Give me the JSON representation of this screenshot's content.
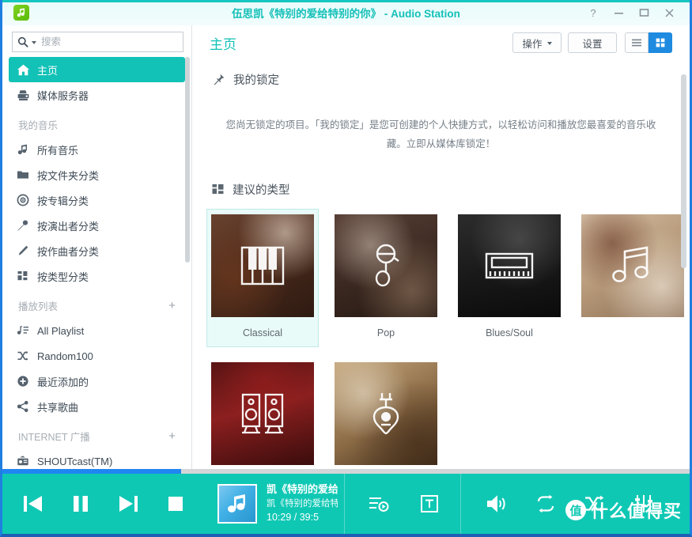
{
  "window": {
    "title": "伍思凯《特别的爱给特别的你》 - Audio Station",
    "app_icon": "music-note-app-icon",
    "accent_teal": "#12c2b6",
    "accent_blue": "#1e8ae0",
    "border_blue": "#1f7fe0",
    "controls": {
      "help": "?",
      "minimize": "—",
      "maximize": "□",
      "close": "✕"
    }
  },
  "sidebar": {
    "search": {
      "placeholder": "搜索",
      "value": ""
    },
    "items": [
      {
        "label": "主页",
        "icon": "home-icon",
        "active": true
      },
      {
        "label": "媒体服务器",
        "icon": "media-server-icon",
        "active": false
      }
    ],
    "groups": [
      {
        "title": "我的音乐",
        "add": "",
        "items": [
          {
            "label": "所有音乐",
            "icon": "music-note-icon"
          },
          {
            "label": "按文件夹分类",
            "icon": "folder-icon"
          },
          {
            "label": "按专辑分类",
            "icon": "disc-icon"
          },
          {
            "label": "按演出者分类",
            "icon": "microphone-icon"
          },
          {
            "label": "按作曲者分类",
            "icon": "pen-icon"
          },
          {
            "label": "按类型分类",
            "icon": "grid-icon"
          }
        ]
      },
      {
        "title": "播放列表",
        "add": "+",
        "items": [
          {
            "label": "All Playlist",
            "icon": "playlist-icon"
          },
          {
            "label": "Random100",
            "icon": "shuffle-icon"
          },
          {
            "label": "最近添加的",
            "icon": "plus-circle-icon"
          },
          {
            "label": "共享歌曲",
            "icon": "share-icon"
          }
        ]
      },
      {
        "title": "INTERNET 广播",
        "add": "+",
        "items": [
          {
            "label": "SHOUTcast(TM)",
            "icon": "radio-icon"
          }
        ]
      }
    ]
  },
  "content": {
    "page_title": "主页",
    "toolbar": {
      "action_label": "操作",
      "settings_label": "设置",
      "list_view_icon": "list-view-icon",
      "grid_view_icon": "grid-view-icon",
      "active_view": "grid"
    },
    "pinned_section": {
      "icon": "pin-icon",
      "title": "我的锁定",
      "empty_message": "您尚无锁定的项目。「我的锁定」是您可创建的个人快捷方式，以轻松访问和播放您最喜爱的音乐收藏。立即从媒体库锁定！"
    },
    "genres_section": {
      "icon": "grid-icon",
      "title": "建议的类型",
      "cards": [
        {
          "label": "Classical",
          "icon": "piano-icon",
          "photo": "ph-classical",
          "selected": true
        },
        {
          "label": "Pop",
          "icon": "microphone-icon",
          "photo": "ph-pop",
          "selected": false
        },
        {
          "label": "Blues/Soul",
          "icon": "harmonica-icon",
          "photo": "ph-blues",
          "selected": false
        },
        {
          "label": "",
          "icon": "double-note-icon",
          "photo": "ph-easy",
          "selected": false
        },
        {
          "label": "",
          "icon": "speakers-icon",
          "photo": "ph-soundtrack",
          "selected": false
        },
        {
          "label": "",
          "icon": "acoustic-guitar-icon",
          "photo": "ph-folk",
          "selected": false
        }
      ]
    }
  },
  "player": {
    "progress_percent": 26,
    "transport": [
      {
        "name": "previous",
        "icon": "previous-icon"
      },
      {
        "name": "pause",
        "icon": "pause-icon"
      },
      {
        "name": "next",
        "icon": "next-icon"
      },
      {
        "name": "stop",
        "icon": "stop-icon"
      }
    ],
    "album_art_icon": "music-note-icon",
    "track_title": "凯《特别的爱给特别的你》",
    "track_subtitle": "凯《特别的爱给特别的你》",
    "time": "10:29 / 39:5",
    "controls": [
      {
        "name": "queue",
        "icon": "playlist-queue-icon"
      },
      {
        "name": "lyrics",
        "icon": "lyrics-text-icon"
      },
      {
        "name": "volume",
        "icon": "volume-icon"
      },
      {
        "name": "repeat",
        "icon": "repeat-icon"
      },
      {
        "name": "shuffle",
        "icon": "shuffle-icon"
      },
      {
        "name": "equalizer",
        "icon": "equalizer-icon"
      }
    ]
  },
  "watermark": {
    "badge": "值",
    "text": "什么值得买"
  }
}
